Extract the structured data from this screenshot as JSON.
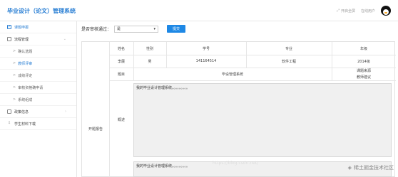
{
  "header": {
    "title": "毕业设计（论文）管理系统",
    "fullscreen_label": "开启全屏",
    "user_label": "在线用户"
  },
  "sidebar": {
    "items": [
      {
        "label": "课题申报",
        "icon": "checkbox-icon",
        "sub": false,
        "chevron": false
      },
      {
        "label": "流程管理",
        "icon": "folder-icon",
        "sub": false,
        "chevron": true
      },
      {
        "label": "确认选题",
        "icon": "",
        "sub": true,
        "chevron": false
      },
      {
        "label": "教师评审",
        "icon": "",
        "sub": true,
        "chevron": false,
        "active": true
      },
      {
        "label": "成绩评定",
        "icon": "",
        "sub": true,
        "chevron": false
      },
      {
        "label": "审核资格确申请",
        "icon": "",
        "sub": true,
        "chevron": false
      },
      {
        "label": "系统组成",
        "icon": "",
        "sub": true,
        "chevron": false
      },
      {
        "label": "政策信息",
        "icon": "document-icon",
        "sub": false,
        "chevron": true
      },
      {
        "label": "学生材料下载",
        "icon": "download-icon",
        "sub": false,
        "chevron": false
      }
    ]
  },
  "filter": {
    "label": "是否审核通过：",
    "select_value": "是",
    "submit_label": "提交"
  },
  "table": {
    "section_label": "开题报告",
    "headers": {
      "name": "姓名",
      "gender": "性别",
      "student_id": "学号",
      "major": "专业",
      "grade": "年级"
    },
    "row": {
      "name": "李展",
      "gender": "男",
      "student_id": "141164514",
      "major": "软件工程",
      "grade": "2014级"
    },
    "topic_label": "题目",
    "topic_value": "毕设管理系统",
    "topic_source": "课题来源",
    "teacher_suggest": "教师建议",
    "overview_label": "概述",
    "overview_text": "我的毕业设计管理系统。。。。。。。。。",
    "overview_text_2": "我的毕业设计管理系统。。。。。。。。。"
  },
  "watermark": {
    "text": "稀土掘金技术社区",
    "url": "https://blog.csdn.net/"
  }
}
